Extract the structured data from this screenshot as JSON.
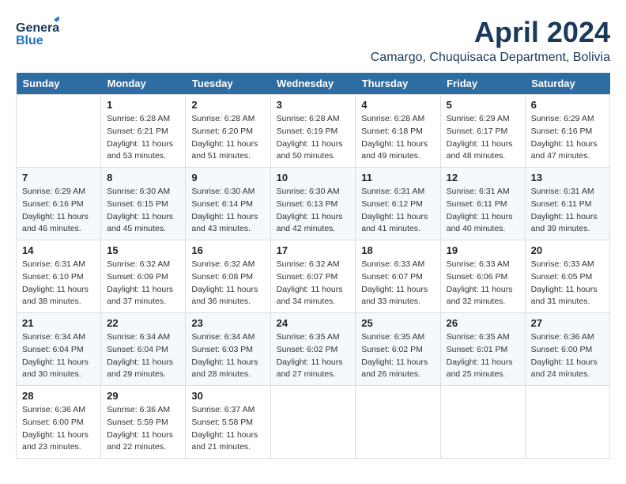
{
  "header": {
    "logo_general": "General",
    "logo_blue": "Blue",
    "month_year": "April 2024",
    "location": "Camargo, Chuquisaca Department, Bolivia"
  },
  "weekdays": [
    "Sunday",
    "Monday",
    "Tuesday",
    "Wednesday",
    "Thursday",
    "Friday",
    "Saturday"
  ],
  "weeks": [
    [
      {
        "day": "",
        "sunrise": "",
        "sunset": "",
        "daylight": ""
      },
      {
        "day": "1",
        "sunrise": "Sunrise: 6:28 AM",
        "sunset": "Sunset: 6:21 PM",
        "daylight": "Daylight: 11 hours and 53 minutes."
      },
      {
        "day": "2",
        "sunrise": "Sunrise: 6:28 AM",
        "sunset": "Sunset: 6:20 PM",
        "daylight": "Daylight: 11 hours and 51 minutes."
      },
      {
        "day": "3",
        "sunrise": "Sunrise: 6:28 AM",
        "sunset": "Sunset: 6:19 PM",
        "daylight": "Daylight: 11 hours and 50 minutes."
      },
      {
        "day": "4",
        "sunrise": "Sunrise: 6:28 AM",
        "sunset": "Sunset: 6:18 PM",
        "daylight": "Daylight: 11 hours and 49 minutes."
      },
      {
        "day": "5",
        "sunrise": "Sunrise: 6:29 AM",
        "sunset": "Sunset: 6:17 PM",
        "daylight": "Daylight: 11 hours and 48 minutes."
      },
      {
        "day": "6",
        "sunrise": "Sunrise: 6:29 AM",
        "sunset": "Sunset: 6:16 PM",
        "daylight": "Daylight: 11 hours and 47 minutes."
      }
    ],
    [
      {
        "day": "7",
        "sunrise": "Sunrise: 6:29 AM",
        "sunset": "Sunset: 6:16 PM",
        "daylight": "Daylight: 11 hours and 46 minutes."
      },
      {
        "day": "8",
        "sunrise": "Sunrise: 6:30 AM",
        "sunset": "Sunset: 6:15 PM",
        "daylight": "Daylight: 11 hours and 45 minutes."
      },
      {
        "day": "9",
        "sunrise": "Sunrise: 6:30 AM",
        "sunset": "Sunset: 6:14 PM",
        "daylight": "Daylight: 11 hours and 43 minutes."
      },
      {
        "day": "10",
        "sunrise": "Sunrise: 6:30 AM",
        "sunset": "Sunset: 6:13 PM",
        "daylight": "Daylight: 11 hours and 42 minutes."
      },
      {
        "day": "11",
        "sunrise": "Sunrise: 6:31 AM",
        "sunset": "Sunset: 6:12 PM",
        "daylight": "Daylight: 11 hours and 41 minutes."
      },
      {
        "day": "12",
        "sunrise": "Sunrise: 6:31 AM",
        "sunset": "Sunset: 6:11 PM",
        "daylight": "Daylight: 11 hours and 40 minutes."
      },
      {
        "day": "13",
        "sunrise": "Sunrise: 6:31 AM",
        "sunset": "Sunset: 6:11 PM",
        "daylight": "Daylight: 11 hours and 39 minutes."
      }
    ],
    [
      {
        "day": "14",
        "sunrise": "Sunrise: 6:31 AM",
        "sunset": "Sunset: 6:10 PM",
        "daylight": "Daylight: 11 hours and 38 minutes."
      },
      {
        "day": "15",
        "sunrise": "Sunrise: 6:32 AM",
        "sunset": "Sunset: 6:09 PM",
        "daylight": "Daylight: 11 hours and 37 minutes."
      },
      {
        "day": "16",
        "sunrise": "Sunrise: 6:32 AM",
        "sunset": "Sunset: 6:08 PM",
        "daylight": "Daylight: 11 hours and 36 minutes."
      },
      {
        "day": "17",
        "sunrise": "Sunrise: 6:32 AM",
        "sunset": "Sunset: 6:07 PM",
        "daylight": "Daylight: 11 hours and 34 minutes."
      },
      {
        "day": "18",
        "sunrise": "Sunrise: 6:33 AM",
        "sunset": "Sunset: 6:07 PM",
        "daylight": "Daylight: 11 hours and 33 minutes."
      },
      {
        "day": "19",
        "sunrise": "Sunrise: 6:33 AM",
        "sunset": "Sunset: 6:06 PM",
        "daylight": "Daylight: 11 hours and 32 minutes."
      },
      {
        "day": "20",
        "sunrise": "Sunrise: 6:33 AM",
        "sunset": "Sunset: 6:05 PM",
        "daylight": "Daylight: 11 hours and 31 minutes."
      }
    ],
    [
      {
        "day": "21",
        "sunrise": "Sunrise: 6:34 AM",
        "sunset": "Sunset: 6:04 PM",
        "daylight": "Daylight: 11 hours and 30 minutes."
      },
      {
        "day": "22",
        "sunrise": "Sunrise: 6:34 AM",
        "sunset": "Sunset: 6:04 PM",
        "daylight": "Daylight: 11 hours and 29 minutes."
      },
      {
        "day": "23",
        "sunrise": "Sunrise: 6:34 AM",
        "sunset": "Sunset: 6:03 PM",
        "daylight": "Daylight: 11 hours and 28 minutes."
      },
      {
        "day": "24",
        "sunrise": "Sunrise: 6:35 AM",
        "sunset": "Sunset: 6:02 PM",
        "daylight": "Daylight: 11 hours and 27 minutes."
      },
      {
        "day": "25",
        "sunrise": "Sunrise: 6:35 AM",
        "sunset": "Sunset: 6:02 PM",
        "daylight": "Daylight: 11 hours and 26 minutes."
      },
      {
        "day": "26",
        "sunrise": "Sunrise: 6:35 AM",
        "sunset": "Sunset: 6:01 PM",
        "daylight": "Daylight: 11 hours and 25 minutes."
      },
      {
        "day": "27",
        "sunrise": "Sunrise: 6:36 AM",
        "sunset": "Sunset: 6:00 PM",
        "daylight": "Daylight: 11 hours and 24 minutes."
      }
    ],
    [
      {
        "day": "28",
        "sunrise": "Sunrise: 6:36 AM",
        "sunset": "Sunset: 6:00 PM",
        "daylight": "Daylight: 11 hours and 23 minutes."
      },
      {
        "day": "29",
        "sunrise": "Sunrise: 6:36 AM",
        "sunset": "Sunset: 5:59 PM",
        "daylight": "Daylight: 11 hours and 22 minutes."
      },
      {
        "day": "30",
        "sunrise": "Sunrise: 6:37 AM",
        "sunset": "Sunset: 5:58 PM",
        "daylight": "Daylight: 11 hours and 21 minutes."
      },
      {
        "day": "",
        "sunrise": "",
        "sunset": "",
        "daylight": ""
      },
      {
        "day": "",
        "sunrise": "",
        "sunset": "",
        "daylight": ""
      },
      {
        "day": "",
        "sunrise": "",
        "sunset": "",
        "daylight": ""
      },
      {
        "day": "",
        "sunrise": "",
        "sunset": "",
        "daylight": ""
      }
    ]
  ]
}
